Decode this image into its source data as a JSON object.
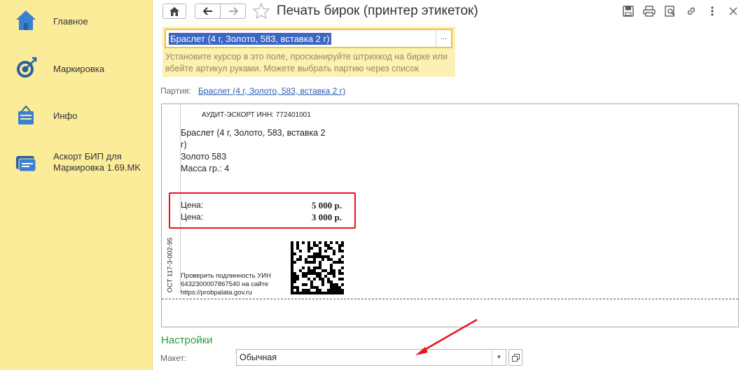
{
  "sidebar": {
    "items": [
      {
        "label": "Главное",
        "icon": "home-icon"
      },
      {
        "label": "Маркировка",
        "icon": "target-icon"
      },
      {
        "label": "Инфо",
        "icon": "info-bag-icon"
      },
      {
        "label": " Аскорт БИП для Маркировка 1.69.MK",
        "icon": "chat-icon"
      }
    ]
  },
  "header": {
    "title": "Печать бирок (принтер этикеток)",
    "buttons": [
      "home-icon",
      "back-arrow-icon",
      "forward-arrow-icon",
      "favorite-star-icon",
      "save-icon",
      "print-icon",
      "preview-icon",
      "link-icon",
      "more-icon",
      "close-icon"
    ]
  },
  "scan": {
    "value": "Браслет (4 г, Золото, 583, вставка 2 г)",
    "hint": "Установите курсор в это поле, просканируйте штрихкод на бирке или вбейте артикул руками. Можете выбрать партию через список",
    "choose_label": "..."
  },
  "partiya": {
    "label": "Партия:",
    "link": "Браслет (4 г, Золото, 583, вставка 2 г)"
  },
  "tag": {
    "org": "АУДИТ-ЭСКОРТ ИНН: 772401001",
    "product_lines": [
      "Браслет (4 г, Золото, 583, вставка 2",
      "г)",
      "Золото 583",
      "Масса гр.: 4"
    ],
    "prices": [
      {
        "label": "Цена:",
        "value": "5 000 р."
      },
      {
        "label": "Цена:",
        "value": "3 000 р."
      }
    ],
    "standard": "ОСТ 117-3-002-95",
    "verify_lines": [
      "Проверить подлинность УИН",
      "6432300007867540 на сайте",
      "https://probpalata.gov.ru"
    ]
  },
  "settings": {
    "title": "Настройки",
    "maket_label": "Макет:",
    "maket_value": "Обычная"
  },
  "colors": {
    "sidebar_bg": "#fbec9a",
    "accent_highlight": "#e8141e",
    "settings_green": "#2f9a3c",
    "link_blue": "#2a5db0"
  }
}
